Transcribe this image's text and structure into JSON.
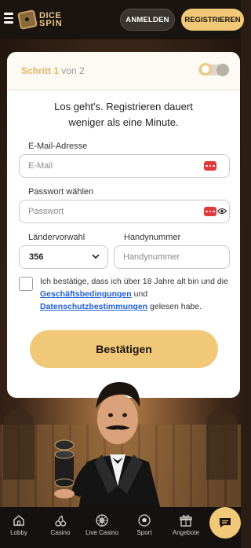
{
  "header": {
    "logo_line1": "DICE",
    "logo_line2": "SPIN",
    "login_label": "ANMELDEN",
    "register_label": "REGISTRIEREN"
  },
  "form": {
    "step_bold": "Schritt 1",
    "step_rest": " von 2",
    "intro_line1": "Los geht's. Registrieren dauert",
    "intro_line2": "weniger als eine Minute.",
    "email_label": "E-Mail-Adresse",
    "email_placeholder": "E-Mail",
    "password_label": "Passwort wählen",
    "password_placeholder": "Passwort",
    "country_code_label": "Ländervorwahl",
    "country_code_value": "356",
    "phone_label": "Handynummer",
    "phone_placeholder": "Handynummer",
    "consent_text1": "Ich bestätige, dass ich über 18 Jahre alt bin und die ",
    "consent_link1": "Geschäftsbedingungen",
    "consent_text2": " und ",
    "consent_link2": "Datenschutzbestimmungen",
    "consent_text3": " gelesen habe.",
    "confirm_label": "Bestätigen"
  },
  "nav": {
    "items": [
      {
        "label": "Lobby",
        "icon": "home-icon"
      },
      {
        "label": "Casino",
        "icon": "cherries-icon"
      },
      {
        "label": "Live Casino",
        "icon": "roulette-icon"
      },
      {
        "label": "Sport",
        "icon": "football-icon"
      },
      {
        "label": "Angebote",
        "icon": "gift-icon"
      }
    ]
  },
  "colors": {
    "accent": "#f0c877",
    "header_bg": "#1a1410",
    "link": "#1f5fd6",
    "field_icon": "#e03a3a"
  }
}
